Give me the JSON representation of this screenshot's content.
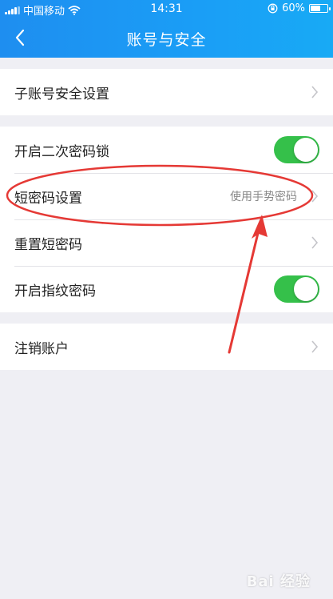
{
  "status_bar": {
    "carrier": "中国移动",
    "time": "14:31",
    "battery_text": "60%",
    "battery_level": 0.6,
    "icons": [
      "signal-icon",
      "wifi-icon",
      "rotation-lock-icon",
      "battery-icon"
    ]
  },
  "header": {
    "title": "账号与安全",
    "back_icon": "back-chevron-icon"
  },
  "groups": [
    {
      "items": [
        {
          "label": "子账号安全设置",
          "control": "chevron"
        }
      ]
    },
    {
      "items": [
        {
          "label": "开启二次密码锁",
          "control": "toggle",
          "on": true
        },
        {
          "label": "短密码设置",
          "value": "使用手势密码",
          "control": "chevron"
        },
        {
          "label": "重置短密码",
          "control": "chevron"
        },
        {
          "label": "开启指纹密码",
          "control": "toggle",
          "on": true
        }
      ]
    },
    {
      "items": [
        {
          "label": "注销账户",
          "control": "chevron"
        }
      ]
    }
  ],
  "watermark": "Bai 经验",
  "colors": {
    "header_gradient_start": "#1e8ef0",
    "header_gradient_end": "#18aaf5",
    "toggle_on": "#35c04a",
    "annotation_red": "#e53935",
    "page_background": "#efeff4"
  }
}
